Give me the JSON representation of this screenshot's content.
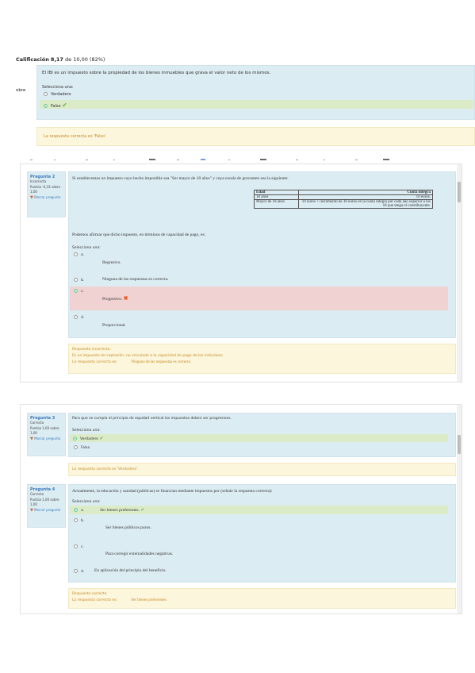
{
  "block1": {
    "grade_label": "Calificación",
    "grade_value": "8,17",
    "grade_rest": "de 10,00 (82%)",
    "side_label": "obre",
    "question": "El IBI es un impuesto sobre la propiedad de los bienes inmuebles que grava el valor neto de los mismos.",
    "select_label": "Selecciona una:",
    "options": [
      "Verdadero",
      "Falso"
    ],
    "feedback": "La respuesta correcta es 'Falso'"
  },
  "q2": {
    "title": "Pregunta 2",
    "status": "Incorrecta",
    "score": "Puntúa -0,33 sobre 1,00",
    "flag": "Marcar pregunta",
    "text": "Si establecemos un impuesto cuyo hecho imponible sea \"Ser mayor de 18 años\" y cuya escala de gravamen sea la siguiente:",
    "table": {
      "headers": [
        "Edad",
        "Cuota íntegra"
      ],
      "rows": [
        [
          "18 años",
          "10 euros."
        ],
        [
          "Mayor de 18 años",
          "10 euros + incremento de 10 euros en la cuota íntegra por cada año superior a los 18 que tenga el contribuyente."
        ]
      ]
    },
    "prompt": "Podemos afirmar que dicho impuesto, en términos de capacidad de pago, es:",
    "select_label": "Selecciona una:",
    "options": [
      {
        "letter": "a.",
        "text": "Regresivo."
      },
      {
        "letter": "b.",
        "text": "Ninguna de las respuestas es correcta."
      },
      {
        "letter": "c.",
        "text": "Progresivo."
      },
      {
        "letter": "d.",
        "text": "Proporcional."
      }
    ],
    "feedback_1": "Respuesta incorrecta.",
    "feedback_2": "Es un impuesto de captación, no vinculado a la capacidad de pago de los individuos.",
    "feedback_3_label": "La respuesta correcta es:",
    "feedback_3_value": "Ninguna de las respuestas es correcta."
  },
  "q3": {
    "title": "Pregunta 3",
    "status": "Correcta",
    "score": "Puntúa 1,00 sobre 1,00",
    "flag": "Marcar pregunta",
    "text": "Para que se cumpla el principio de equidad vertical los impuestos deben ser progresivos.",
    "select_label": "Selecciona una:",
    "options": [
      "Verdadero",
      "Falso"
    ],
    "feedback": "La respuesta correcta es 'Verdadero'"
  },
  "q4": {
    "title": "Pregunta 4",
    "status": "Correcta",
    "score": "Puntúa 1,00 sobre 1,00",
    "flag": "Marcar pregunta",
    "text": "Actualmente, la educación y sanidad (públicas) se financian mediante impuestos por (señale la respuesta correcta):",
    "select_label": "Selecciona una:",
    "options": [
      {
        "letter": "a.",
        "text": "Ser bienes preferentes."
      },
      {
        "letter": "b.",
        "text": "Ser bienes públicos puros."
      },
      {
        "letter": "c.",
        "text": "Para corregir externalidades negativas."
      },
      {
        "letter": "d.",
        "text": "En aplicación del principio del beneficio."
      }
    ],
    "feedback_1": "Respuesta correcta",
    "feedback_2_label": "La respuesta correcta es:",
    "feedback_2_value": "Ser bienes preferentes."
  },
  "colors": {
    "content_bg": "#dcecf3",
    "feedback_bg": "#fcf6dc",
    "correct_bg": "#dcebc7",
    "wrong_bg": "#f1d2d2",
    "link": "#3a7ab7",
    "feedback_text": "#c58a26"
  },
  "icons": [
    "check-icon",
    "cross-icon",
    "flag-icon",
    "radio-icon"
  ]
}
